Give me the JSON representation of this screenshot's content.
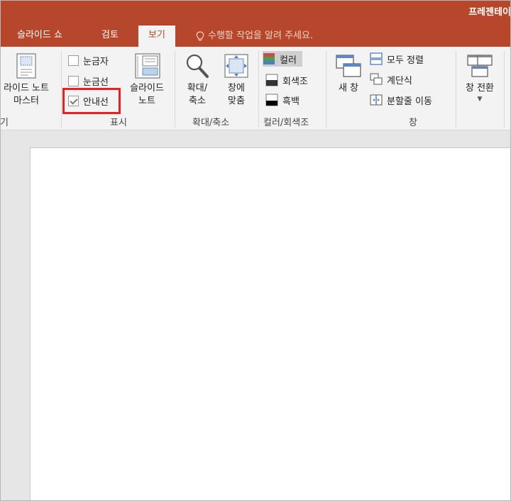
{
  "app": {
    "title": "프레젠테이"
  },
  "tabs": [
    {
      "label": "슬라이드 쇼"
    },
    {
      "label": "검토"
    },
    {
      "label": "보기",
      "active": true
    }
  ],
  "tell_me": {
    "placeholder": "수행할 작업을 알려 주세요."
  },
  "ribbon": {
    "master": {
      "notes_master": {
        "line1": "라이드 노트",
        "line2": "마스터"
      },
      "group_label": "기"
    },
    "show": {
      "group_label": "표시",
      "ruler": {
        "label": "눈금자",
        "checked": false
      },
      "gridlines": {
        "label": "눈금선",
        "checked": false
      },
      "guides": {
        "label": "안내선",
        "checked": true
      },
      "slide_notes": {
        "line1": "슬라이드",
        "line2": "노트"
      }
    },
    "zoom": {
      "group_label": "확대/축소",
      "zoom_button": {
        "line1": "확대/",
        "line2": "축소"
      },
      "fit_button": {
        "line1": "창에",
        "line2": "맞춤"
      }
    },
    "color": {
      "group_label": "컬러/회색조",
      "color": {
        "label": "컬러",
        "selected": true
      },
      "grayscale": {
        "label": "회색조"
      },
      "black_white": {
        "label": "흑백"
      }
    },
    "window": {
      "group_label": "창",
      "new_window": {
        "label": "새 창"
      },
      "arrange_all": {
        "label": "모두 정렬"
      },
      "cascade": {
        "label": "계단식"
      },
      "move_split": {
        "label": "분할줄 이동"
      }
    },
    "switch": {
      "switch_windows": {
        "label": "창 전환"
      }
    }
  },
  "colors": {
    "accent": "#b7472a",
    "highlight_box": "#e8201f"
  }
}
